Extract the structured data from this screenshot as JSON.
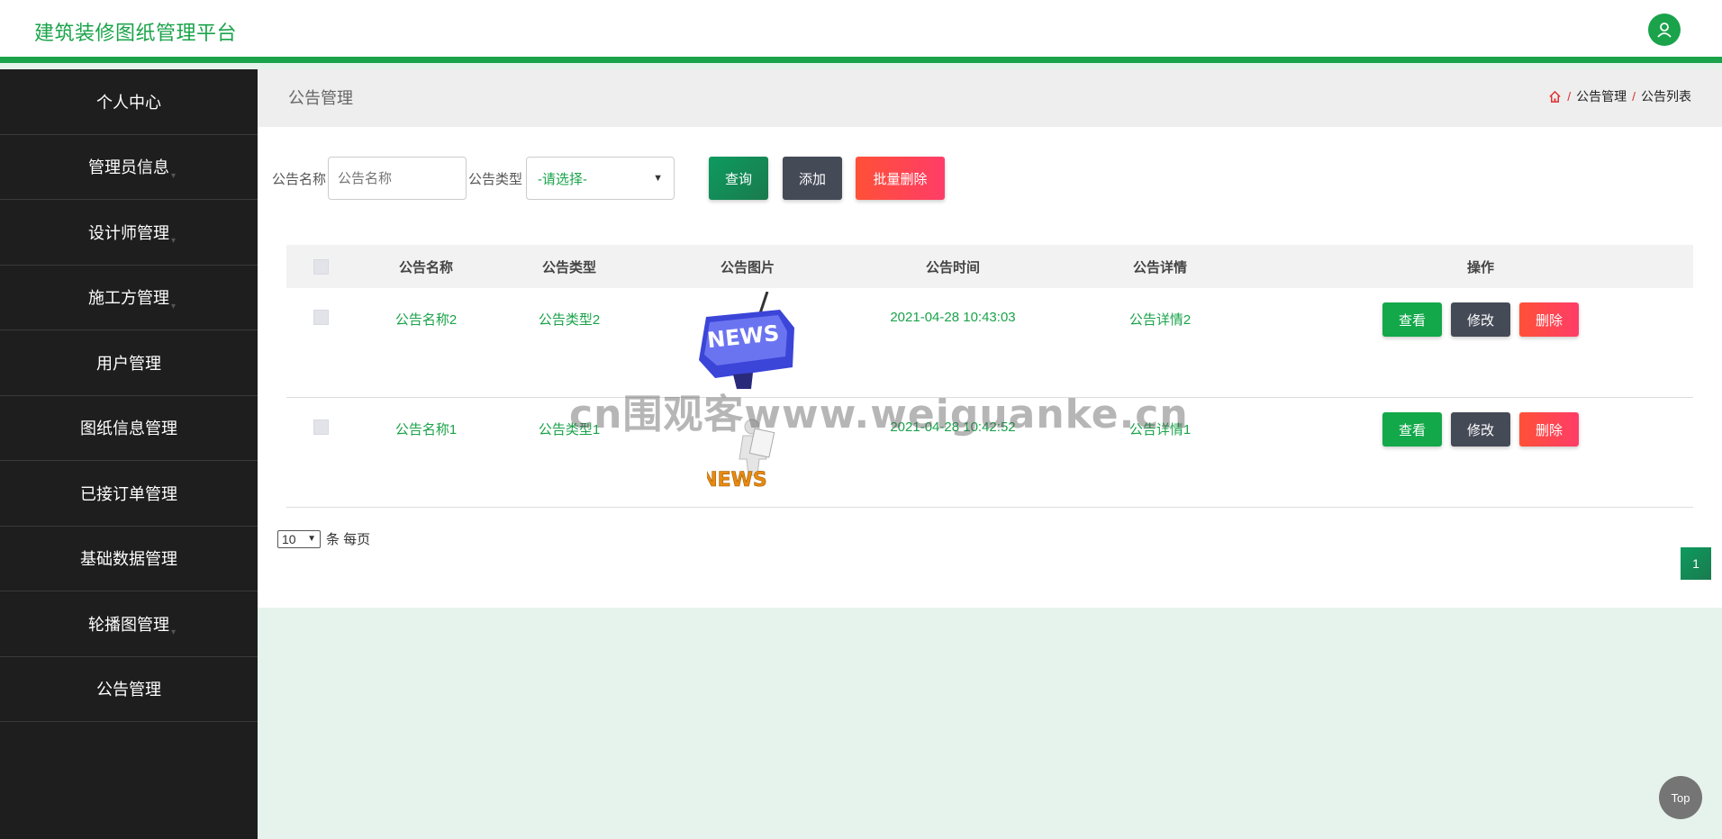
{
  "header": {
    "title": "建筑装修图纸管理平台",
    "avatar_icon": "user-icon"
  },
  "sidebar": {
    "items": [
      {
        "label": "个人中心"
      },
      {
        "label": "管理员信息"
      },
      {
        "label": "设计师管理"
      },
      {
        "label": "施工方管理"
      },
      {
        "label": "用户管理"
      },
      {
        "label": "图纸信息管理"
      },
      {
        "label": "已接订单管理"
      },
      {
        "label": "基础数据管理"
      },
      {
        "label": "轮播图管理"
      },
      {
        "label": "公告管理"
      }
    ]
  },
  "page": {
    "title": "公告管理",
    "breadcrumb": {
      "home_icon": "home-icon",
      "sep": "/",
      "level1": "公告管理",
      "level2": "公告列表"
    }
  },
  "search": {
    "name_label": "公告名称",
    "name_placeholder": "公告名称",
    "type_label": "公告类型",
    "type_selected": "-请选择-",
    "query_label": "查询",
    "add_label": "添加",
    "batch_delete_label": "批量删除"
  },
  "table": {
    "headers": {
      "name": "公告名称",
      "type": "公告类型",
      "image": "公告图片",
      "time": "公告时间",
      "detail": "公告详情",
      "ops": "操作"
    },
    "rows": [
      {
        "name": "公告名称2",
        "type": "公告类型2",
        "image_text": "NEWS",
        "time": "2021-04-28 10:43:03",
        "detail": "公告详情2",
        "view": "查看",
        "edit": "修改",
        "delete": "删除"
      },
      {
        "name": "公告名称1",
        "type": "公告类型1",
        "image_text": "NEWS",
        "time": "2021-04-28 10:42:52",
        "detail": "公告详情1",
        "view": "查看",
        "edit": "修改",
        "delete": "删除"
      }
    ]
  },
  "pagination": {
    "page_size": "10",
    "per_page_text": "条 每页",
    "current_page": "1"
  },
  "watermark": "cn围观客www.weiguanke.cn",
  "top_button": "Top",
  "colors": {
    "accent": "#1aa34a",
    "sidebar_bg": "#1e1e1e",
    "danger": "#ff4455",
    "dark_button": "#454a57"
  }
}
